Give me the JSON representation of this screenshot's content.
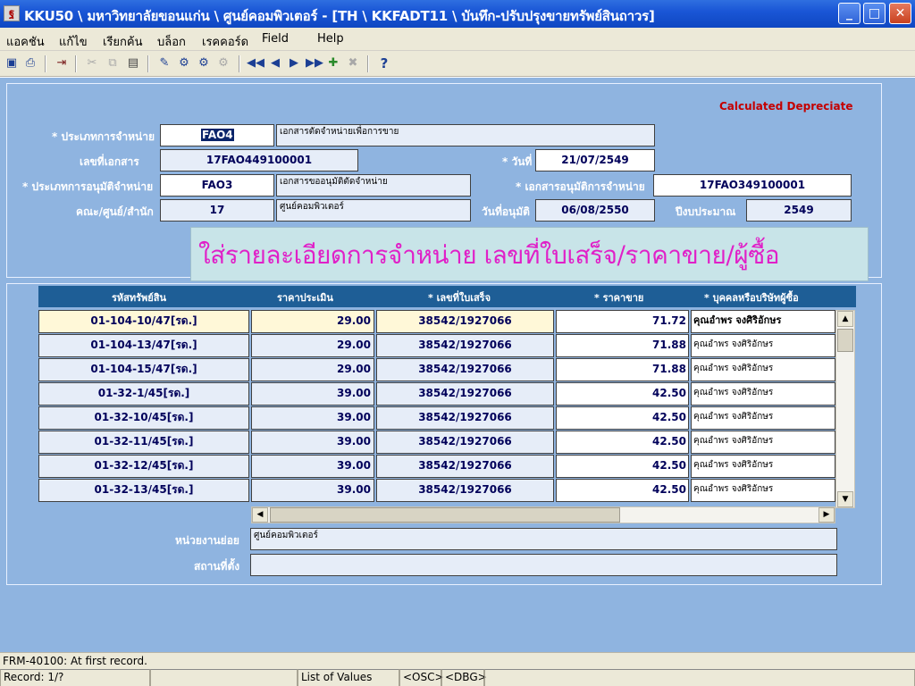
{
  "window": {
    "title": "KKU50 \\ มหาวิทยาลัยขอนแก่น \\ ศูนย์คอมพิวเตอร์ - [TH \\ KKFADT11 \\ บันทึก-ปรับปรุงขายทรัพย์สินถาวร]",
    "icon_text": "ฐ"
  },
  "menu": [
    "แอคชัน",
    "แก้ไข",
    "เรียกค้น",
    "บล็อก",
    "เรคคอร์ด",
    "Field",
    "Help"
  ],
  "toolbar_icons": [
    "save-icon",
    "print-preview-icon",
    "exit-icon",
    "cut-icon",
    "copy-icon",
    "paste-icon",
    "enter-query-icon",
    "execute-query-icon",
    "cancel-query-icon",
    "count-query-icon",
    "first-record-icon",
    "previous-record-icon",
    "next-record-icon",
    "last-record-icon",
    "insert-record-icon",
    "delete-record-icon",
    "help-icon"
  ],
  "header": {
    "calc_label": "Calculated Depreciate",
    "disposal_type_label": "* ประเภทการจำหน่าย",
    "disposal_type_code": "FAO4",
    "disposal_type_desc": "เอกสารตัดจำหน่ายเพื่อการขาย",
    "doc_no_label": "เลขที่เอกสาร",
    "doc_no": "17FAO449100001",
    "date_label": "* วันที่",
    "date": "21/07/2549",
    "approval_type_label": "* ประเภทการอนุมัติจำหน่าย",
    "approval_type_code": "FAO3",
    "approval_type_desc": "เอกสารขออนุมัติตัดจำหน่าย",
    "approval_doc_label": "* เอกสารอนุมัติการจำหน่าย",
    "approval_doc": "17FAO349100001",
    "faculty_label": "คณะ/ศูนย์/สำนัก",
    "faculty_code": "17",
    "faculty_name": "ศูนย์คอมพิวเตอร์",
    "approve_date_label": "วันที่อนุมัติ",
    "approve_date": "06/08/2550",
    "budget_year_label": "ปีงบประมาณ",
    "budget_year": "2549"
  },
  "banner_text": "ใส่รายละเอียดการจำหน่าย เลขที่ใบเสร็จ/ราคาขาย/ผู้ซื้อ",
  "table": {
    "columns": [
      "รหัสทรัพย์สิน",
      "ราคาประเมิน",
      "* เลขที่ใบเสร็จ",
      "* ราคาขาย",
      "* บุคคลหรือบริษัทผู้ซื้อ"
    ],
    "rows": [
      {
        "code": "01-104-10/47[รด.]",
        "price": "29.00",
        "receipt": "38542/1927066",
        "sale": "71.72",
        "buyer": "คุณอำพร จงศิริอักษร"
      },
      {
        "code": "01-104-13/47[รด.]",
        "price": "29.00",
        "receipt": "38542/1927066",
        "sale": "71.88",
        "buyer": "คุณอำพร จงศิริอักษร"
      },
      {
        "code": "01-104-15/47[รด.]",
        "price": "29.00",
        "receipt": "38542/1927066",
        "sale": "71.88",
        "buyer": "คุณอำพร จงศิริอักษร"
      },
      {
        "code": "01-32-1/45[รด.]",
        "price": "39.00",
        "receipt": "38542/1927066",
        "sale": "42.50",
        "buyer": "คุณอำพร จงศิริอักษร"
      },
      {
        "code": "01-32-10/45[รด.]",
        "price": "39.00",
        "receipt": "38542/1927066",
        "sale": "42.50",
        "buyer": "คุณอำพร จงศิริอักษร"
      },
      {
        "code": "01-32-11/45[รด.]",
        "price": "39.00",
        "receipt": "38542/1927066",
        "sale": "42.50",
        "buyer": "คุณอำพร จงศิริอักษร"
      },
      {
        "code": "01-32-12/45[รด.]",
        "price": "39.00",
        "receipt": "38542/1927066",
        "sale": "42.50",
        "buyer": "คุณอำพร จงศิริอักษร"
      },
      {
        "code": "01-32-13/45[รด.]",
        "price": "39.00",
        "receipt": "38542/1927066",
        "sale": "42.50",
        "buyer": "คุณอำพร จงศิริอักษร"
      }
    ]
  },
  "footer": {
    "sub_unit_label": "หน่วยงานย่อย",
    "sub_unit": "ศูนย์คอมพิวเตอร์",
    "location_label": "สถานที่ตั้ง",
    "location": ""
  },
  "status": {
    "message": "FRM-40100: At first record.",
    "record": "Record: 1/?",
    "lov": "List of Values",
    "osc": "<OSC>",
    "dbg": "<DBG>"
  },
  "colors": {
    "background": "#8fb4e0",
    "header_bg": "#1e5e96",
    "banner_text": "#e020c8",
    "calc_text": "#c40000"
  }
}
